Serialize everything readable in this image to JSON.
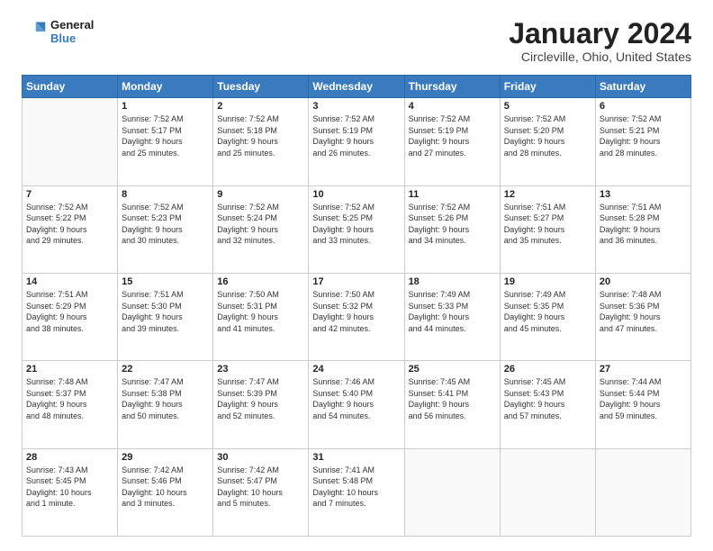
{
  "logo": {
    "line1": "General",
    "line2": "Blue"
  },
  "header": {
    "title": "January 2024",
    "subtitle": "Circleville, Ohio, United States"
  },
  "days_of_week": [
    "Sunday",
    "Monday",
    "Tuesday",
    "Wednesday",
    "Thursday",
    "Friday",
    "Saturday"
  ],
  "weeks": [
    [
      {
        "day": "",
        "info": ""
      },
      {
        "day": "1",
        "info": "Sunrise: 7:52 AM\nSunset: 5:17 PM\nDaylight: 9 hours\nand 25 minutes."
      },
      {
        "day": "2",
        "info": "Sunrise: 7:52 AM\nSunset: 5:18 PM\nDaylight: 9 hours\nand 25 minutes."
      },
      {
        "day": "3",
        "info": "Sunrise: 7:52 AM\nSunset: 5:19 PM\nDaylight: 9 hours\nand 26 minutes."
      },
      {
        "day": "4",
        "info": "Sunrise: 7:52 AM\nSunset: 5:19 PM\nDaylight: 9 hours\nand 27 minutes."
      },
      {
        "day": "5",
        "info": "Sunrise: 7:52 AM\nSunset: 5:20 PM\nDaylight: 9 hours\nand 28 minutes."
      },
      {
        "day": "6",
        "info": "Sunrise: 7:52 AM\nSunset: 5:21 PM\nDaylight: 9 hours\nand 28 minutes."
      }
    ],
    [
      {
        "day": "7",
        "info": "Sunrise: 7:52 AM\nSunset: 5:22 PM\nDaylight: 9 hours\nand 29 minutes."
      },
      {
        "day": "8",
        "info": "Sunrise: 7:52 AM\nSunset: 5:23 PM\nDaylight: 9 hours\nand 30 minutes."
      },
      {
        "day": "9",
        "info": "Sunrise: 7:52 AM\nSunset: 5:24 PM\nDaylight: 9 hours\nand 32 minutes."
      },
      {
        "day": "10",
        "info": "Sunrise: 7:52 AM\nSunset: 5:25 PM\nDaylight: 9 hours\nand 33 minutes."
      },
      {
        "day": "11",
        "info": "Sunrise: 7:52 AM\nSunset: 5:26 PM\nDaylight: 9 hours\nand 34 minutes."
      },
      {
        "day": "12",
        "info": "Sunrise: 7:51 AM\nSunset: 5:27 PM\nDaylight: 9 hours\nand 35 minutes."
      },
      {
        "day": "13",
        "info": "Sunrise: 7:51 AM\nSunset: 5:28 PM\nDaylight: 9 hours\nand 36 minutes."
      }
    ],
    [
      {
        "day": "14",
        "info": "Sunrise: 7:51 AM\nSunset: 5:29 PM\nDaylight: 9 hours\nand 38 minutes."
      },
      {
        "day": "15",
        "info": "Sunrise: 7:51 AM\nSunset: 5:30 PM\nDaylight: 9 hours\nand 39 minutes."
      },
      {
        "day": "16",
        "info": "Sunrise: 7:50 AM\nSunset: 5:31 PM\nDaylight: 9 hours\nand 41 minutes."
      },
      {
        "day": "17",
        "info": "Sunrise: 7:50 AM\nSunset: 5:32 PM\nDaylight: 9 hours\nand 42 minutes."
      },
      {
        "day": "18",
        "info": "Sunrise: 7:49 AM\nSunset: 5:33 PM\nDaylight: 9 hours\nand 44 minutes."
      },
      {
        "day": "19",
        "info": "Sunrise: 7:49 AM\nSunset: 5:35 PM\nDaylight: 9 hours\nand 45 minutes."
      },
      {
        "day": "20",
        "info": "Sunrise: 7:48 AM\nSunset: 5:36 PM\nDaylight: 9 hours\nand 47 minutes."
      }
    ],
    [
      {
        "day": "21",
        "info": "Sunrise: 7:48 AM\nSunset: 5:37 PM\nDaylight: 9 hours\nand 48 minutes."
      },
      {
        "day": "22",
        "info": "Sunrise: 7:47 AM\nSunset: 5:38 PM\nDaylight: 9 hours\nand 50 minutes."
      },
      {
        "day": "23",
        "info": "Sunrise: 7:47 AM\nSunset: 5:39 PM\nDaylight: 9 hours\nand 52 minutes."
      },
      {
        "day": "24",
        "info": "Sunrise: 7:46 AM\nSunset: 5:40 PM\nDaylight: 9 hours\nand 54 minutes."
      },
      {
        "day": "25",
        "info": "Sunrise: 7:45 AM\nSunset: 5:41 PM\nDaylight: 9 hours\nand 56 minutes."
      },
      {
        "day": "26",
        "info": "Sunrise: 7:45 AM\nSunset: 5:43 PM\nDaylight: 9 hours\nand 57 minutes."
      },
      {
        "day": "27",
        "info": "Sunrise: 7:44 AM\nSunset: 5:44 PM\nDaylight: 9 hours\nand 59 minutes."
      }
    ],
    [
      {
        "day": "28",
        "info": "Sunrise: 7:43 AM\nSunset: 5:45 PM\nDaylight: 10 hours\nand 1 minute."
      },
      {
        "day": "29",
        "info": "Sunrise: 7:42 AM\nSunset: 5:46 PM\nDaylight: 10 hours\nand 3 minutes."
      },
      {
        "day": "30",
        "info": "Sunrise: 7:42 AM\nSunset: 5:47 PM\nDaylight: 10 hours\nand 5 minutes."
      },
      {
        "day": "31",
        "info": "Sunrise: 7:41 AM\nSunset: 5:48 PM\nDaylight: 10 hours\nand 7 minutes."
      },
      {
        "day": "",
        "info": ""
      },
      {
        "day": "",
        "info": ""
      },
      {
        "day": "",
        "info": ""
      }
    ]
  ]
}
